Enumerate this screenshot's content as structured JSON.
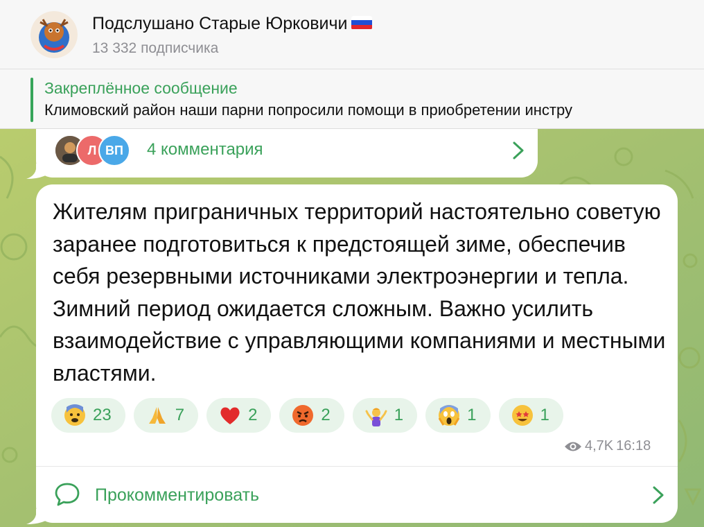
{
  "header": {
    "channel_title": "Подслушано Старые Юрковичи",
    "subscribers": "13 332 подписчика"
  },
  "pinned": {
    "title": "Закреплённое сообщение",
    "text": "Климовский район наши парни попросили помощи в приобретении инстру"
  },
  "top_post": {
    "commenter_initials": [
      "Л",
      "ВП"
    ],
    "comments_count": "4 комментария"
  },
  "message": {
    "text": "Жителям приграничных территорий настоятельно советую заранее подготовиться к предстоящей зиме, обеспечив себя резервными источниками электроэнергии и тепла. Зимний период ожидается сложным. Важно усилить взаимодействие с управляющими компаниями и местными властями.",
    "views": "4,7K",
    "time": "16:18",
    "reactions": [
      {
        "emoji": "fearful-face",
        "count": "23"
      },
      {
        "emoji": "folded-hands",
        "count": "7"
      },
      {
        "emoji": "red-heart",
        "count": "2"
      },
      {
        "emoji": "angry-face",
        "count": "2"
      },
      {
        "emoji": "person-shrugging",
        "count": "1"
      },
      {
        "emoji": "screaming-face",
        "count": "1"
      },
      {
        "emoji": "star-struck",
        "count": "1"
      }
    ],
    "comment_action": "Прокомментировать"
  },
  "colors": {
    "accent": "#3aa15a",
    "wallpaper": "#a9c26a",
    "reaction_bg": "#e8f4ea"
  }
}
